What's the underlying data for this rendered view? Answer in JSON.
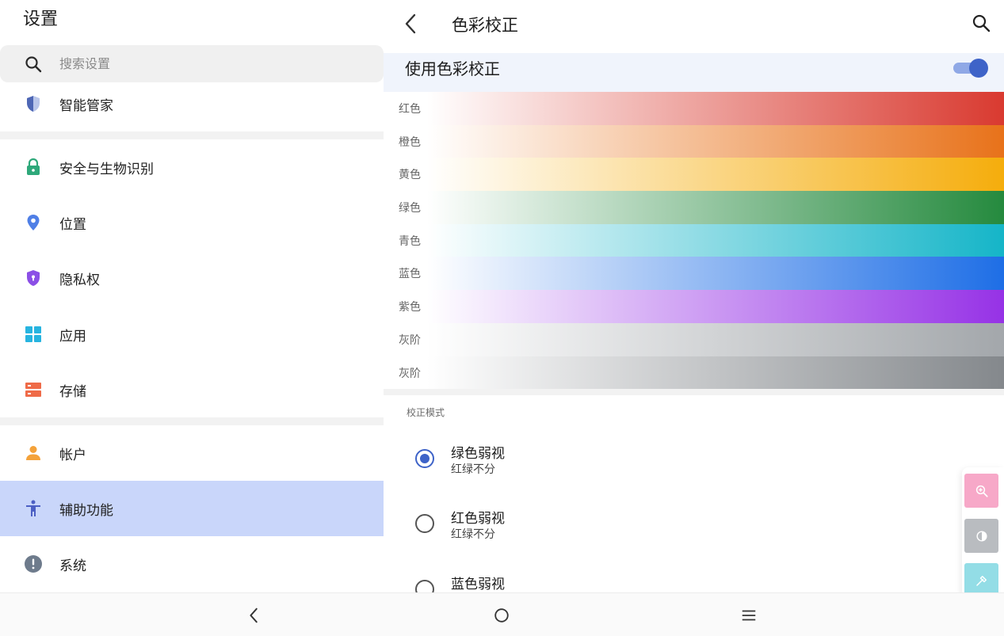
{
  "left_panel": {
    "title": "设置",
    "search": {
      "placeholder": "搜索设置"
    },
    "items": [
      {
        "label": "智能管家",
        "icon": "shield-half-icon",
        "color": "#6b83c4"
      },
      {
        "label": "安全与生物识别",
        "icon": "lock-icon",
        "color": "#2ea87a"
      },
      {
        "label": "位置",
        "icon": "location-pin-icon",
        "color": "#4f7fe6"
      },
      {
        "label": "隐私权",
        "icon": "privacy-shield-icon",
        "color": "#8b4fe6"
      },
      {
        "label": "应用",
        "icon": "apps-grid-icon",
        "color": "#27b4e0"
      },
      {
        "label": "存储",
        "icon": "storage-icon",
        "color": "#ef6b48"
      },
      {
        "label": "帐户",
        "icon": "person-icon",
        "color": "#f4a23a"
      },
      {
        "label": "辅助功能",
        "icon": "accessibility-icon",
        "color": "#4c5fc4",
        "active": true
      },
      {
        "label": "系统",
        "icon": "info-alert-icon",
        "color": "#6e7b8c"
      }
    ]
  },
  "right_panel": {
    "title": "色彩校正",
    "switch": {
      "label": "使用色彩校正",
      "on": true
    },
    "bands": [
      {
        "label": "红色",
        "color": "#d93a30"
      },
      {
        "label": "橙色",
        "color": "#e8721a"
      },
      {
        "label": "黄色",
        "color": "#f5ad0c"
      },
      {
        "label": "绿色",
        "color": "#258a3e"
      },
      {
        "label": "青色",
        "color": "#15b5c8"
      },
      {
        "label": "蓝色",
        "color": "#1e6ee6"
      },
      {
        "label": "紫色",
        "color": "#9632e6"
      },
      {
        "label": "灰阶",
        "color": "#a3a7ab"
      },
      {
        "label": "灰阶",
        "color": "#84888c"
      }
    ],
    "section_label": "校正模式",
    "modes": [
      {
        "title": "绿色弱视",
        "subtitle": "红绿不分",
        "checked": true
      },
      {
        "title": "红色弱视",
        "subtitle": "红绿不分",
        "checked": false
      },
      {
        "title": "蓝色弱视",
        "subtitle": "",
        "checked": false
      }
    ]
  },
  "floating_tools": [
    {
      "icon": "zoom-in-icon",
      "color": "#f7a8c8"
    },
    {
      "icon": "contrast-icon",
      "color": "#b9bcc0"
    },
    {
      "icon": "eyedropper-icon",
      "color": "#93dde6"
    }
  ],
  "navbar": {
    "buttons": [
      "back-icon",
      "home-icon",
      "menu-icon"
    ]
  }
}
